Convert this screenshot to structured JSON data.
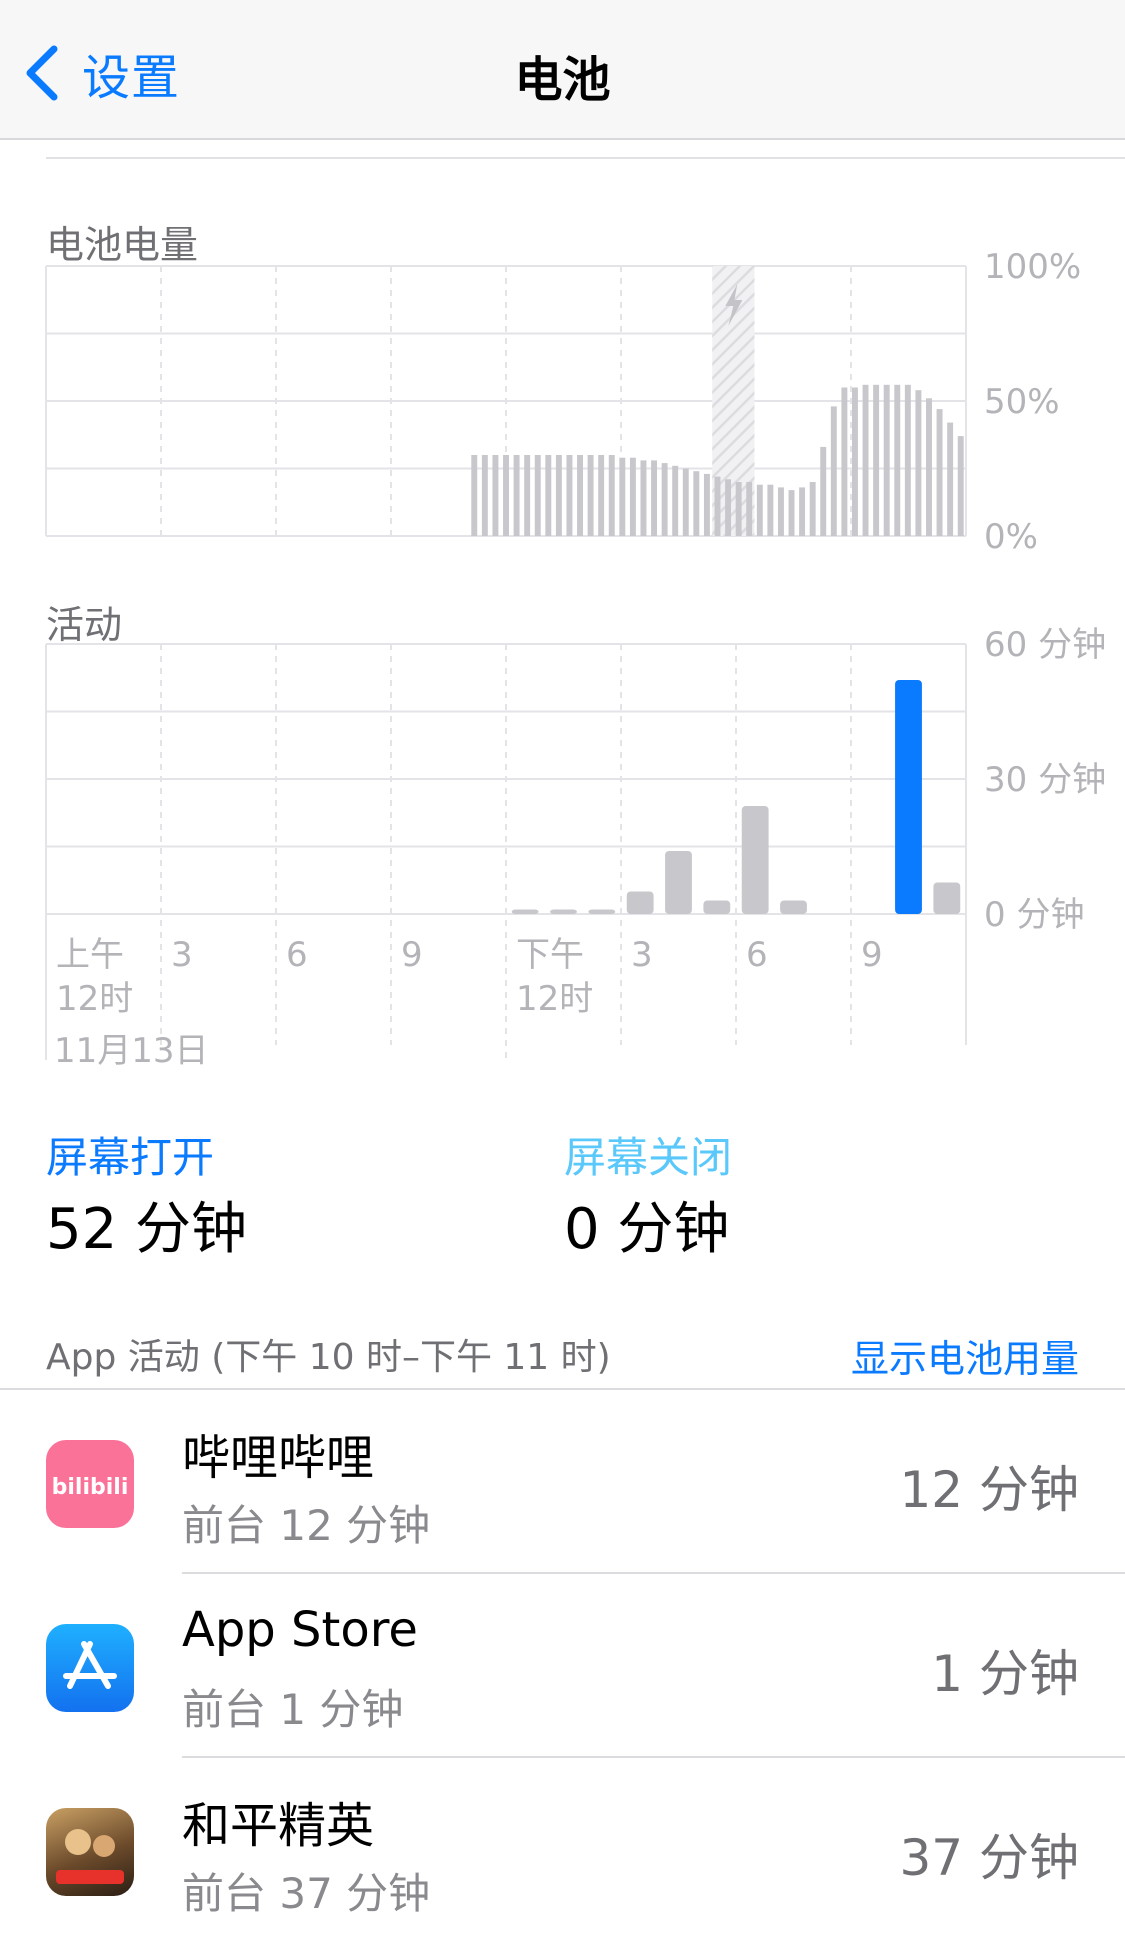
{
  "nav": {
    "back_label": "设置",
    "title": "电池"
  },
  "battery_section": {
    "label": "电池电量"
  },
  "activity_section": {
    "label": "活动"
  },
  "chart_data": [
    {
      "type": "bar",
      "title": "电池电量",
      "ylim": [
        0,
        100
      ],
      "yticks": [
        "100%",
        "50%",
        "0%"
      ],
      "grid": true,
      "charging_window": [
        63,
        67
      ],
      "series": [
        {
          "values": [
            0,
            0,
            0,
            0,
            0,
            0,
            0,
            0,
            0,
            0,
            0,
            0,
            0,
            0,
            0,
            0,
            0,
            0,
            0,
            0,
            0,
            0,
            0,
            0,
            0,
            0,
            0,
            0,
            0,
            0,
            0,
            0,
            0,
            0,
            0,
            0,
            0,
            0,
            0,
            0,
            30,
            30,
            30,
            30,
            30,
            30,
            30,
            30,
            30,
            30,
            30,
            30,
            30,
            30,
            29,
            29,
            28,
            28,
            27,
            26,
            25,
            24,
            23,
            22,
            21,
            20,
            20,
            19,
            19,
            18,
            17,
            18,
            20,
            33,
            48,
            55,
            55,
            56,
            56,
            56,
            56,
            56,
            54,
            51,
            47,
            42,
            37
          ]
        }
      ],
      "green_range": [
        87,
        91
      ]
    },
    {
      "type": "bar",
      "title": "活动",
      "ylim": [
        0,
        60
      ],
      "yticks": [
        "60 分钟",
        "30 分钟",
        "0 分钟"
      ],
      "grid": true,
      "xticks": [
        "上午\n12时",
        "3",
        "6",
        "9",
        "下午\n12时",
        "3",
        "6",
        "9"
      ],
      "date_label": "11月13日",
      "series": [
        {
          "name": "屏幕打开",
          "values": [
            0,
            0,
            0,
            0,
            0,
            0,
            0,
            0,
            0,
            0,
            0,
            0,
            0,
            0,
            0,
            0,
            0,
            0,
            0,
            0,
            0,
            0,
            0,
            0,
            0,
            0,
            0,
            0,
            0,
            0,
            0,
            0,
            0,
            0,
            0,
            0,
            0,
            0,
            0,
            0,
            0,
            0,
            0,
            0,
            0,
            0,
            0,
            0,
            0,
            0,
            0,
            0,
            0,
            52,
            0
          ],
          "highlight_index": 22
        },
        {
          "name": "屏幕关闭",
          "values": [
            0,
            0,
            0,
            0,
            0,
            0,
            0,
            0,
            0,
            0,
            0,
            0,
            0,
            0,
            0,
            0,
            0,
            0,
            0,
            0,
            0,
            0,
            0,
            0,
            0,
            0,
            0,
            0,
            0,
            0,
            0,
            0,
            0,
            0,
            0,
            0,
            0,
            0,
            0,
            0,
            0,
            0,
            0,
            0,
            0,
            0,
            0,
            0,
            0,
            0,
            0,
            0,
            0,
            0,
            0
          ]
        }
      ],
      "hourly": [
        0,
        0,
        0,
        0,
        0,
        0,
        0,
        0,
        0,
        0,
        0,
        0,
        0,
        0,
        0,
        0,
        0,
        0,
        0,
        0,
        0,
        0,
        52,
        0
      ],
      "hourly_grey": [
        0,
        0,
        0,
        0,
        0,
        0,
        0,
        0,
        0,
        0,
        0,
        0,
        1,
        1,
        1,
        5,
        14,
        3,
        24,
        3,
        0,
        0,
        0,
        7
      ]
    }
  ],
  "stats": {
    "screen_on_label": "屏幕打开",
    "screen_on_value": "52 分钟",
    "screen_off_label": "屏幕关闭",
    "screen_off_value": "0 分钟"
  },
  "app_activity": {
    "header": "App 活动 (下午 10 时–下午 11 时)",
    "show_battery": "显示电池用量",
    "apps": [
      {
        "name": "哔哩哔哩",
        "sub": "前台 12 分钟",
        "time": "12 分钟",
        "icon": "bilibili-icon",
        "icon_text": "bilibili",
        "color": "#fb7299"
      },
      {
        "name": "App Store",
        "sub": "前台 1 分钟",
        "time": "1 分钟",
        "icon": "app-store-icon",
        "color": "#1a8cff"
      },
      {
        "name": "和平精英",
        "sub": "前台 37 分钟",
        "time": "37 分钟",
        "icon": "peacekeeper-elite-icon",
        "color": "#6b4a2b"
      }
    ]
  },
  "colors": {
    "accent": "#0a7aff",
    "stat_off": "#5ac8fa",
    "battery_green": "#34c759",
    "bar_grey": "#c7c7cc"
  }
}
